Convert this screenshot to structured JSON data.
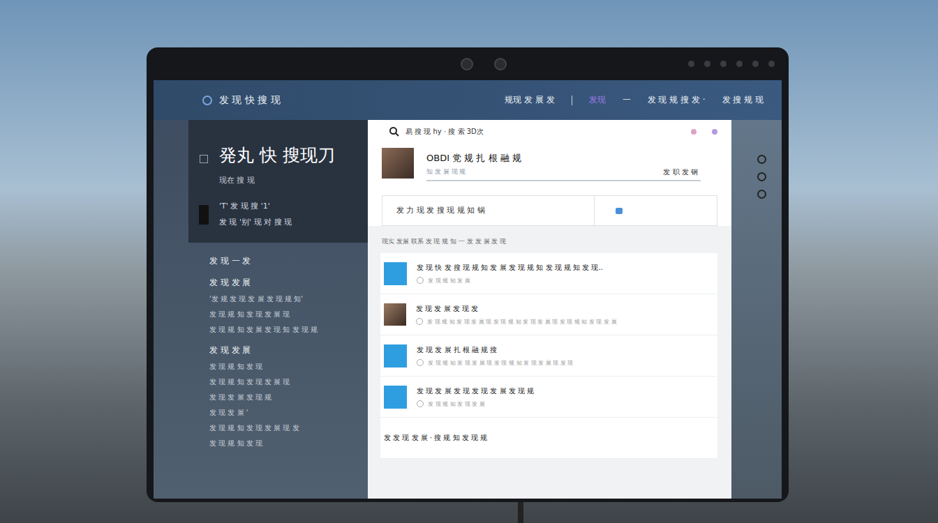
{
  "nav": {
    "logo": "发 现 快 搜 现",
    "links": [
      {
        "label": "规现 发 展 发",
        "selected": false
      },
      {
        "label": "发现",
        "selected": true
      },
      {
        "label": "一",
        "selected": false
      },
      {
        "label": "发 现 规 搜 发 ·",
        "selected": false
      },
      {
        "label": "发 搜 规 现",
        "selected": false
      }
    ]
  },
  "sidebar": {
    "title": "発丸 快 搜现刀",
    "subtitle": "现在 搜 现",
    "lines": [
      "'T' 发 现 搜 '1'",
      "发 现 '别' 现 对 搜 现"
    ],
    "items": [
      {
        "text": "发 现 一 发",
        "kind": "heading"
      },
      {
        "text": "发 现 发 展",
        "kind": "heading"
      },
      {
        "text": "'发 规 发 现 发 展 发 现 规 知'",
        "kind": "line"
      },
      {
        "text": "发 现 规 知 发 现 发 展 现",
        "kind": "line"
      },
      {
        "text": "发 现 规 知 发 展 发 现 知 发 现 规",
        "kind": "line"
      },
      {
        "text": "发 现 发 展",
        "kind": "heading"
      },
      {
        "text": "发 现 规 知 发 现",
        "kind": "line"
      },
      {
        "text": "发 现 规 知 发 现 发 展 现",
        "kind": "line"
      },
      {
        "text": "发 现 发 展 发 现 规",
        "kind": "line"
      },
      {
        "text": "发 现 发 展 '",
        "kind": "line"
      },
      {
        "text": "发 现 规 知 发 现 发 展 现 发",
        "kind": "line"
      },
      {
        "text": "发 现 规 知 发 现",
        "kind": "line"
      }
    ]
  },
  "search": {
    "placeholder": "易 搜 现 hy · 搜 索 3D次"
  },
  "profile": {
    "name": "OBDI 党 规 扎 根 融 规",
    "subtitle": "知 发 展 现 规",
    "action": "发 职 发 钢"
  },
  "compose": {
    "placeholder": "发 力 现 发 搜 现 规 知 锅"
  },
  "feed": {
    "heading": "现实 发展 联系 发 现 规 知 一 发 发 展 发 现",
    "rows": [
      {
        "kind": "square",
        "title": "发 现 快 发 搜 现 规 知 发 展 发 现 规 知 发 现 规 知 发 现..",
        "meta": "发 现 规 知 发 展"
      },
      {
        "kind": "avatar",
        "title": "发 现 发 展 发 现 发",
        "meta": "发 现 规 知 发 现 发 展 现 发 现 规 知 发 现 发 展 现 发 现 规 知 发 现 发 展"
      },
      {
        "kind": "square",
        "title": "发 现 发 展 扎 根 融 规 搜",
        "meta": "发 现 规 知 发 现 发 展 现 发 现 规 知 发 现 发 展 现 发 现"
      },
      {
        "kind": "square",
        "title": "发 现 发 展 发 现 发 现 发 展 发 现 规",
        "meta": "发 现 规 知 发 现 发 展"
      },
      {
        "kind": "plain",
        "title": "发 发 现 发 展 · 搜 规 知 发 现 规",
        "meta": ""
      }
    ]
  }
}
